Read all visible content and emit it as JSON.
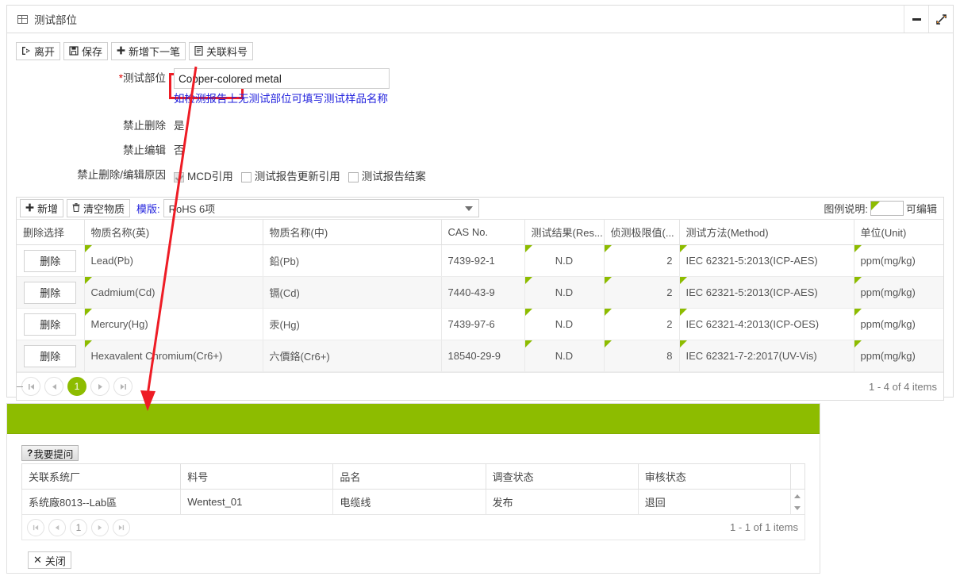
{
  "window": {
    "title": "测试部位",
    "icon": "grid-icon",
    "minimize_icon": "minimize-icon",
    "expand_icon": "expand-icon"
  },
  "toolbar": {
    "buttons": [
      {
        "label": "离开",
        "icon": "exit-icon",
        "glyph": "➠"
      },
      {
        "label": "保存",
        "icon": "save-icon",
        "glyph": "🖫"
      },
      {
        "label": "新增下一笔",
        "icon": "plus-icon",
        "glyph": "✚"
      },
      {
        "label": "关联料号",
        "icon": "document-link-icon",
        "glyph": "🗎"
      }
    ],
    "highlighted_button": "关联料号"
  },
  "form": {
    "test_part": {
      "label": "测试部位",
      "required_mark": "*",
      "value": "Copper-colored metal",
      "placeholder": "",
      "hint": "如检测报告上无测试部位可填写测试样品名称"
    },
    "forbid_delete": {
      "label": "禁止删除",
      "value": "是"
    },
    "forbid_edit": {
      "label": "禁止编辑",
      "value": "否"
    },
    "reason": {
      "label": "禁止删除/编辑原因",
      "checkboxes": [
        {
          "label": "MCD引用",
          "checked": true
        },
        {
          "label": "测试报告更新引用",
          "checked": false
        },
        {
          "label": "测试报告结案",
          "checked": false
        }
      ]
    }
  },
  "grid": {
    "toolbar": {
      "add_label": "新增",
      "add_icon": "plus-icon",
      "clear_label": "清空物质",
      "clear_icon": "trash-icon",
      "template_label": "模版:",
      "template_value": "RoHS 6项",
      "dropdown_icon": "chevron-down-icon",
      "legend_label": "图例说明:",
      "legend_value": "可编辑"
    },
    "columns": [
      "删除选择",
      "物质名称(英)",
      "物质名称(中)",
      "CAS No.",
      "测试结果(Res...",
      "侦测极限值(...",
      "测试方法(Method)",
      "单位(Unit)"
    ],
    "delete_label": "删除",
    "rows": [
      {
        "name_en": "Lead(Pb)",
        "name_cn": "鉛(Pb)",
        "cas": "7439-92-1",
        "result": "N.D",
        "limit": "2",
        "method": "IEC 62321-5:2013(ICP-AES)",
        "unit": "ppm(mg/kg)"
      },
      {
        "name_en": "Cadmium(Cd)",
        "name_cn": "镉(Cd)",
        "cas": "7440-43-9",
        "result": "N.D",
        "limit": "2",
        "method": "IEC 62321-5:2013(ICP-AES)",
        "unit": "ppm(mg/kg)"
      },
      {
        "name_en": "Mercury(Hg)",
        "name_cn": "汞(Hg)",
        "cas": "7439-97-6",
        "result": "N.D",
        "limit": "2",
        "method": "IEC 62321-4:2013(ICP-OES)",
        "unit": "ppm(mg/kg)"
      },
      {
        "name_en": "Hexavalent Chromium(Cr6+)",
        "name_cn": "六價鉻(Cr6+)",
        "cas": "18540-29-9",
        "result": "N.D",
        "limit": "8",
        "method": "IEC 62321-7-2:2017(UV-Vis)",
        "unit": "ppm(mg/kg)"
      }
    ],
    "pager": {
      "first_icon": "page-first-icon",
      "prev_icon": "page-prev-icon",
      "current_page": "1",
      "next_icon": "page-next-icon",
      "last_icon": "page-last-icon",
      "info": "1 - 4 of 4 items"
    }
  },
  "popup": {
    "ask_button": {
      "label": "我要提问",
      "icon": "question-icon",
      "glyph": "?"
    },
    "columns": [
      "关联系统厂",
      "料号",
      "品名",
      "调查状态",
      "审核状态"
    ],
    "rows": [
      {
        "system_plant": "系统廠8013--Lab區",
        "part_no": "Wentest_01",
        "product_name": "电缆线",
        "survey_status": "发布",
        "review_status": "退回"
      }
    ],
    "pager": {
      "first_icon": "page-first-icon",
      "prev_icon": "page-prev-icon",
      "current_page": "1",
      "next_icon": "page-next-icon",
      "last_icon": "page-last-icon",
      "info": "1 - 1 of 1 items"
    },
    "close_button": {
      "label": "关闭",
      "icon": "close-icon",
      "glyph": "✕"
    }
  },
  "annotation": {
    "color": "#ee1c25",
    "type": "arrow-pointer"
  },
  "colors": {
    "accent_green": "#8DBC00",
    "link_blue": "#2222DD",
    "annotation_red": "#EE1C25"
  }
}
